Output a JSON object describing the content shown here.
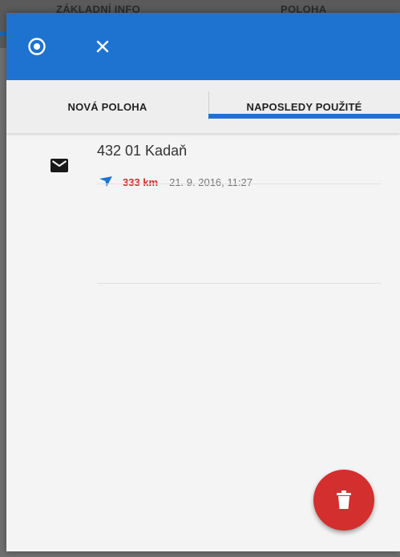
{
  "background": {
    "tab_left": "ZÁKLADNÍ INFO",
    "tab_right": "POLOHA"
  },
  "toolbar": {
    "gps_icon": "gps-target-icon",
    "close_icon": "close-icon"
  },
  "tabs": [
    {
      "label": "NOVÁ POLOHA",
      "active": false
    },
    {
      "label": "NAPOSLEDY POUŽITÉ",
      "active": true
    }
  ],
  "items": [
    {
      "icon": "envelope-icon",
      "title": "432 01 Kadaň",
      "direction_icon": "direction-arrow-icon",
      "distance": "333 km",
      "date": "21. 9. 2016, 11:27"
    }
  ],
  "fab": {
    "icon": "trash-icon"
  },
  "colors": {
    "primary": "#1e73d0",
    "accent": "#d32f2f",
    "background": "#f4f4f4"
  }
}
